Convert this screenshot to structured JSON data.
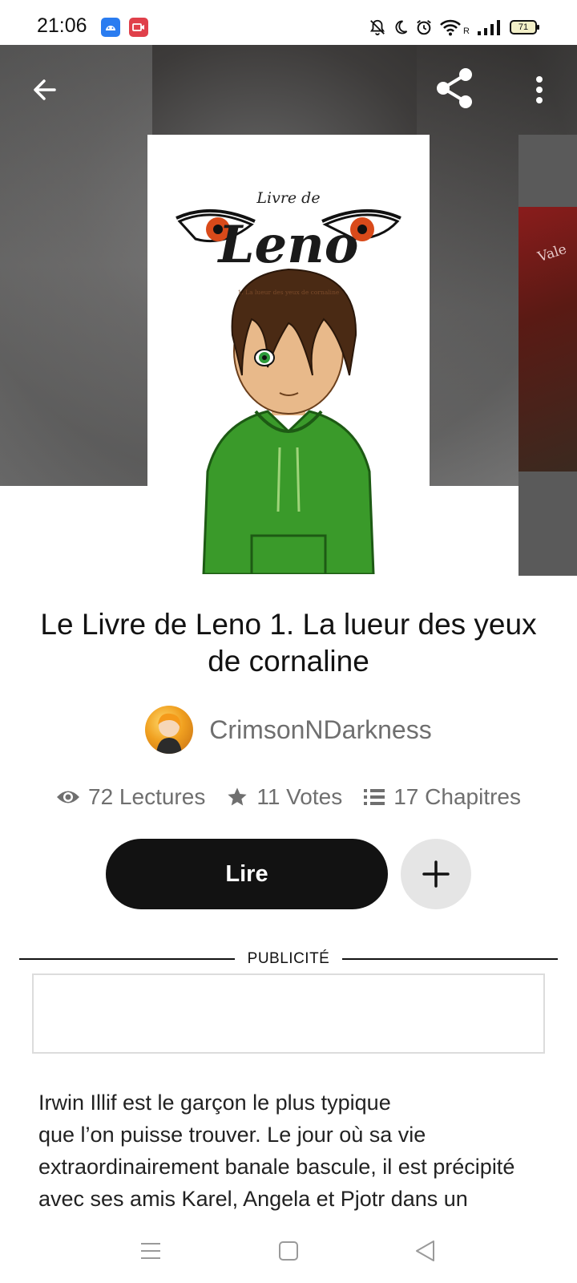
{
  "status_bar": {
    "time": "21:06",
    "battery": "71",
    "network_label": "R",
    "icons": [
      "android-icon",
      "screen-record-icon",
      "mute-icon",
      "moon-icon",
      "alarm-icon",
      "wifi-icon",
      "signal-icon",
      "battery-icon"
    ]
  },
  "header": {
    "icons": [
      "back-arrow-icon",
      "share-icon",
      "more-vertical-icon"
    ]
  },
  "cover": {
    "small_title": "Livre de",
    "big_title": "Leno",
    "subtitle": "1. La lueur des yeux de cornaline",
    "next_cover_text": "Vale"
  },
  "book": {
    "title": "Le Livre de Leno 1. La lueur des yeux de cornaline",
    "author": "CrimsonNDarkness",
    "stats": {
      "reads": "72 Lectures",
      "votes": "11 Votes",
      "chapters": "17 Chapitres"
    },
    "read_button": "Lire",
    "ad_label": "PUBLICITÉ",
    "description": "Irwin Illif est le garçon le plus typique\nque l’on puisse trouver. Le jour où sa vie\nextraordinairement banale bascule, il est précipité\navec ses amis Karel, Angela et Pjotr dans un"
  },
  "colors": {
    "primary_button": "#121212",
    "secondary_button": "#e5e5e5",
    "muted_text": "#6f6f6f",
    "hoodie": "#3a9a2a",
    "hair": "#4a2a14",
    "eye": "#d94a1a"
  }
}
